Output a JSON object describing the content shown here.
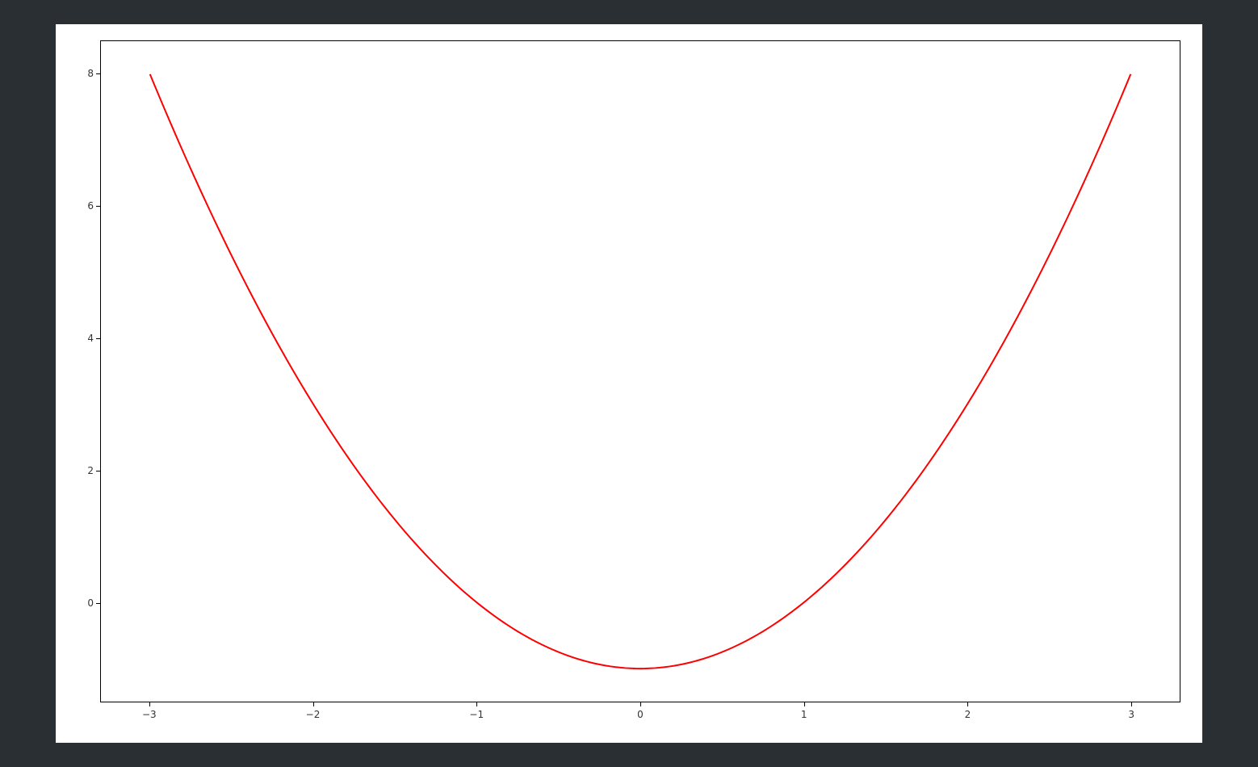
{
  "chart_data": {
    "type": "line",
    "function": "y = x^2 - 1",
    "x": [
      -3,
      -2.7,
      -2.4,
      -2.1,
      -1.8,
      -1.5,
      -1.2,
      -0.9,
      -0.6,
      -0.3,
      0,
      0.3,
      0.6,
      0.9,
      1.2,
      1.5,
      1.8,
      2.1,
      2.4,
      2.7,
      3
    ],
    "y": [
      8,
      6.29,
      4.76,
      3.41,
      2.24,
      1.25,
      0.44,
      -0.19,
      -0.64,
      -0.91,
      -1,
      -0.91,
      -0.64,
      -0.19,
      0.44,
      1.25,
      2.24,
      3.41,
      4.76,
      6.29,
      8
    ],
    "title": "",
    "xlabel": "",
    "ylabel": "",
    "xlim": [
      -3.3,
      3.3
    ],
    "ylim": [
      -1.5,
      8.5
    ],
    "x_ticks": [
      -3,
      -2,
      -1,
      0,
      1,
      2,
      3
    ],
    "y_ticks": [
      0,
      2,
      4,
      6,
      8
    ],
    "line_color": "#ff0000",
    "line_width": 2,
    "grid": false
  },
  "labels": {
    "x_tick_neg3": "−3",
    "x_tick_neg2": "−2",
    "x_tick_neg1": "−1",
    "x_tick_0": "0",
    "x_tick_1": "1",
    "x_tick_2": "2",
    "x_tick_3": "3",
    "y_tick_0": "0",
    "y_tick_2": "2",
    "y_tick_4": "4",
    "y_tick_6": "6",
    "y_tick_8": "8"
  }
}
